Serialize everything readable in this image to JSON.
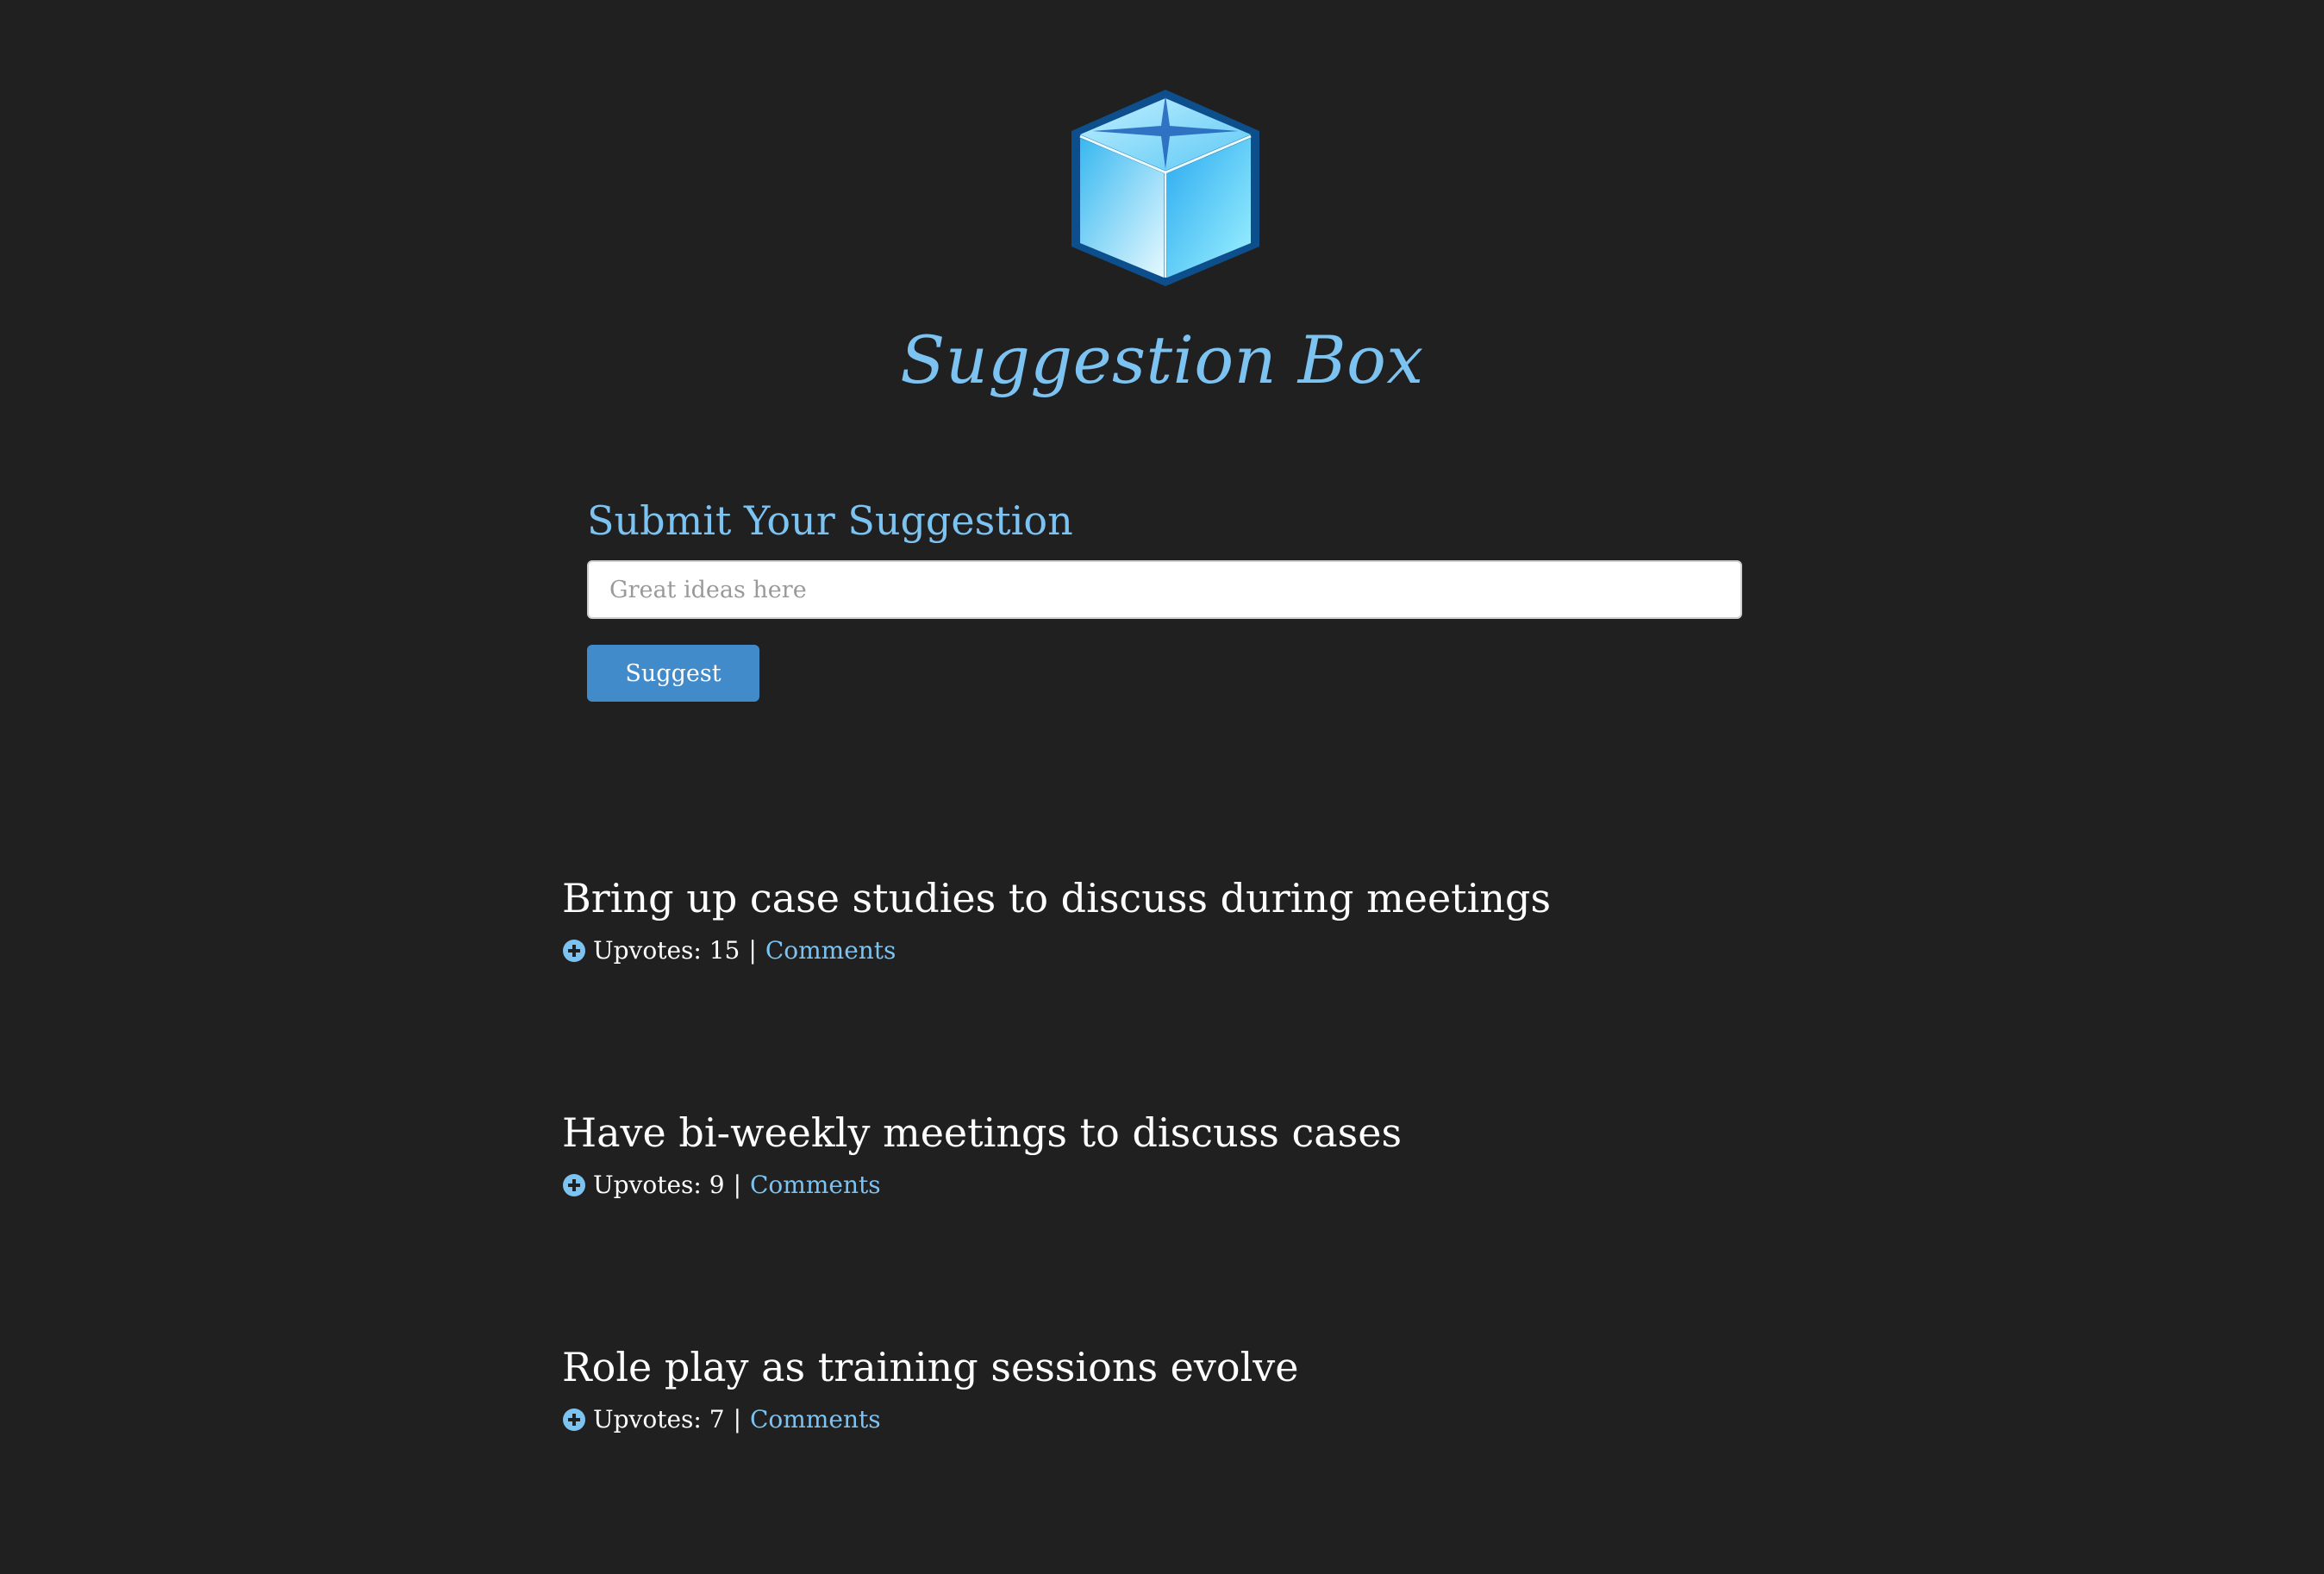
{
  "header": {
    "logo_icon": "cube-icon",
    "title": "Suggestion Box"
  },
  "form": {
    "heading": "Submit Your Suggestion",
    "input_value": "",
    "input_placeholder": "Great ideas here",
    "submit_label": "Suggest"
  },
  "suggestions": [
    {
      "title": "Bring up case studies to discuss during meetings",
      "upvotes_label": "Upvotes:",
      "upvotes": 15,
      "separator": "|",
      "comments_label": "Comments"
    },
    {
      "title": "Have bi-weekly meetings to discuss cases",
      "upvotes_label": "Upvotes:",
      "upvotes": 9,
      "separator": "|",
      "comments_label": "Comments"
    },
    {
      "title": "Role play as training sessions evolve",
      "upvotes_label": "Upvotes:",
      "upvotes": 7,
      "separator": "|",
      "comments_label": "Comments"
    }
  ],
  "colors": {
    "background": "#202020",
    "accent": "#7cc3f2",
    "button": "#428bca",
    "text": "#ffffff"
  }
}
